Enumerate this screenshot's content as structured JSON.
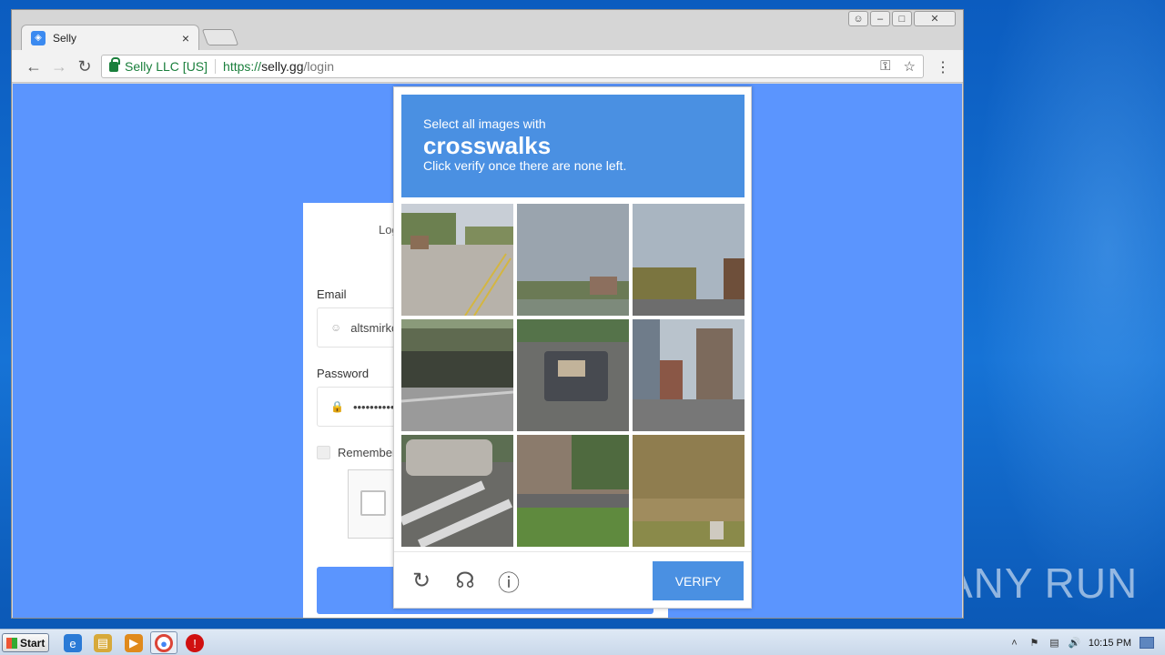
{
  "browser": {
    "tab_title": "Selly",
    "tab_close": "×",
    "site_name": "Selly LLC [US]",
    "url_scheme": "https://",
    "url_host": "selly.gg",
    "url_path": "/login"
  },
  "login": {
    "title": "Log",
    "email_label": "Email",
    "email_value": "altsmirkc",
    "password_label": "Password",
    "password_value": "•••••••••••",
    "remember_label": "Remember"
  },
  "captcha": {
    "instruction_line1": "Select all images with",
    "target_word": "crosswalks",
    "instruction_line3": "Click verify once there are none left.",
    "verify_label": "VERIFY"
  },
  "taskbar": {
    "start_label": "Start",
    "clock": "10:15 PM"
  },
  "watermark": {
    "text": "ANY RUN"
  }
}
